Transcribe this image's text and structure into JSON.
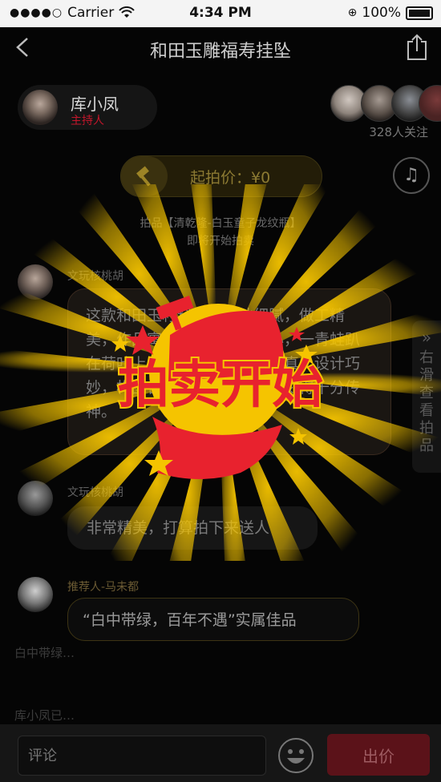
{
  "status": {
    "carrier": "Carrier",
    "time": "4:34 PM",
    "battery": "100%"
  },
  "nav": {
    "title": "和田玉雕福寿挂坠"
  },
  "host": {
    "name": "库小凤",
    "role": "主持人"
  },
  "followers": {
    "count_label": "328人关注"
  },
  "auction": {
    "start_price_label": "起拍价：¥0",
    "lot_line1": "拍品【清乾隆-白玉童子龙纹瓶】",
    "lot_line2": "即将开始拍卖"
  },
  "messages": [
    {
      "name": "文玩核桃胡",
      "text": "这款和田玉籽料挂件质地细腻，做工精美，作品寓意福寿，独具匠心，一青蛙趴在荷叶上，造型生动，形象逼真，设计巧妙，构图合理，刀法流畅，雕刻得十分传神。"
    },
    {
      "name": "文玩核桃胡",
      "text": "非常精美，打算拍下来送人"
    },
    {
      "name": "推荐人-马未都",
      "text": "“白中带绿，百年不遇”实属佳品"
    }
  ],
  "side_tab": {
    "chevron": "»",
    "label": "右滑查看拍品"
  },
  "stray_texts": {
    "a": "白中带绿…",
    "b": "库小凤已…"
  },
  "overlay": {
    "banner_text": "拍卖开始"
  },
  "bottom": {
    "comment_placeholder": "评论",
    "bid_label": "出价"
  },
  "colors": {
    "accent_red": "#c3162b",
    "gold": "#f5c400",
    "banner_red": "#e8222e"
  }
}
